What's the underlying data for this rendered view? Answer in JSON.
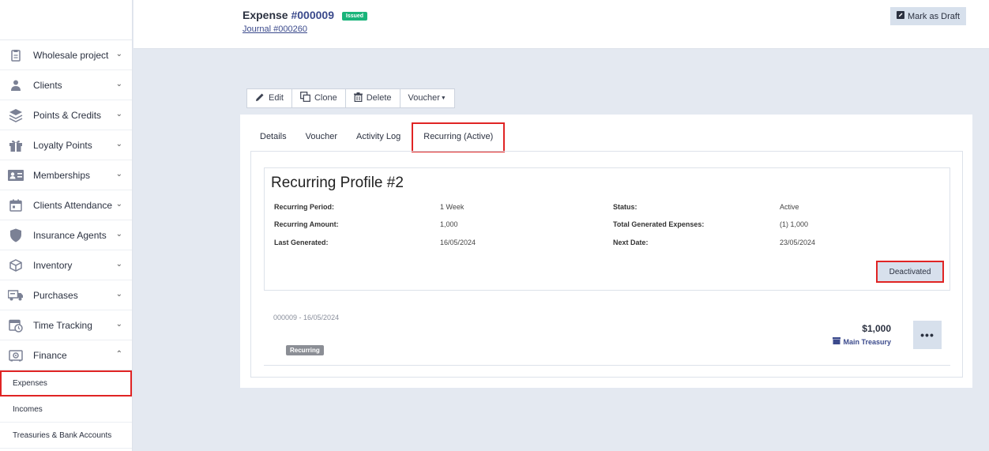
{
  "sidebar": {
    "items": [
      {
        "label": "Wholesale project",
        "icon": "clipboard-icon"
      },
      {
        "label": "Clients",
        "icon": "user-icon"
      },
      {
        "label": "Points & Credits",
        "icon": "layers-icon"
      },
      {
        "label": "Loyalty Points",
        "icon": "gift-icon"
      },
      {
        "label": "Memberships",
        "icon": "id-card-icon"
      },
      {
        "label": "Clients Attendance",
        "icon": "calendar-icon"
      },
      {
        "label": "Insurance Agents",
        "icon": "shield-icon"
      },
      {
        "label": "Inventory",
        "icon": "box-icon"
      },
      {
        "label": "Purchases",
        "icon": "truck-icon"
      },
      {
        "label": "Time Tracking",
        "icon": "calendar-clock-icon"
      },
      {
        "label": "Finance",
        "icon": "safe-icon"
      }
    ],
    "finance_sub": [
      {
        "label": "Expenses"
      },
      {
        "label": "Incomes"
      },
      {
        "label": "Treasuries & Bank Accounts"
      }
    ]
  },
  "header": {
    "title_prefix": "Expense",
    "title_number": "#000009",
    "status_badge": "Issued",
    "journal_link": "Journal #000260",
    "mark_draft_label": "Mark as Draft"
  },
  "toolbar": {
    "edit": "Edit",
    "clone": "Clone",
    "delete": "Delete",
    "voucher": "Voucher"
  },
  "tabs": [
    "Details",
    "Voucher",
    "Activity Log",
    "Recurring (Active)"
  ],
  "profile": {
    "title": "Recurring Profile #2",
    "fields": {
      "period_label": "Recurring Period:",
      "period_value": "1 Week",
      "amount_label": "Recurring Amount:",
      "amount_value": "1,000",
      "last_label": "Last Generated:",
      "last_value": "16/05/2024",
      "status_label": "Status:",
      "status_value": "Active",
      "total_label": "Total Generated Expenses:",
      "total_value": "(1) 1,000",
      "next_label": "Next Date:",
      "next_value": "23/05/2024"
    },
    "deactivated_label": "Deactivated"
  },
  "entry": {
    "ref": "000009 - 16/05/2024",
    "badge": "Recurring",
    "amount": "$1,000",
    "treasury": "Main Treasury",
    "more": "•••"
  },
  "colors": {
    "accent": "#3b4a8c",
    "issued_badge": "#19b47a",
    "highlight_border": "#e02424",
    "page_bg": "#e4e9f1"
  }
}
